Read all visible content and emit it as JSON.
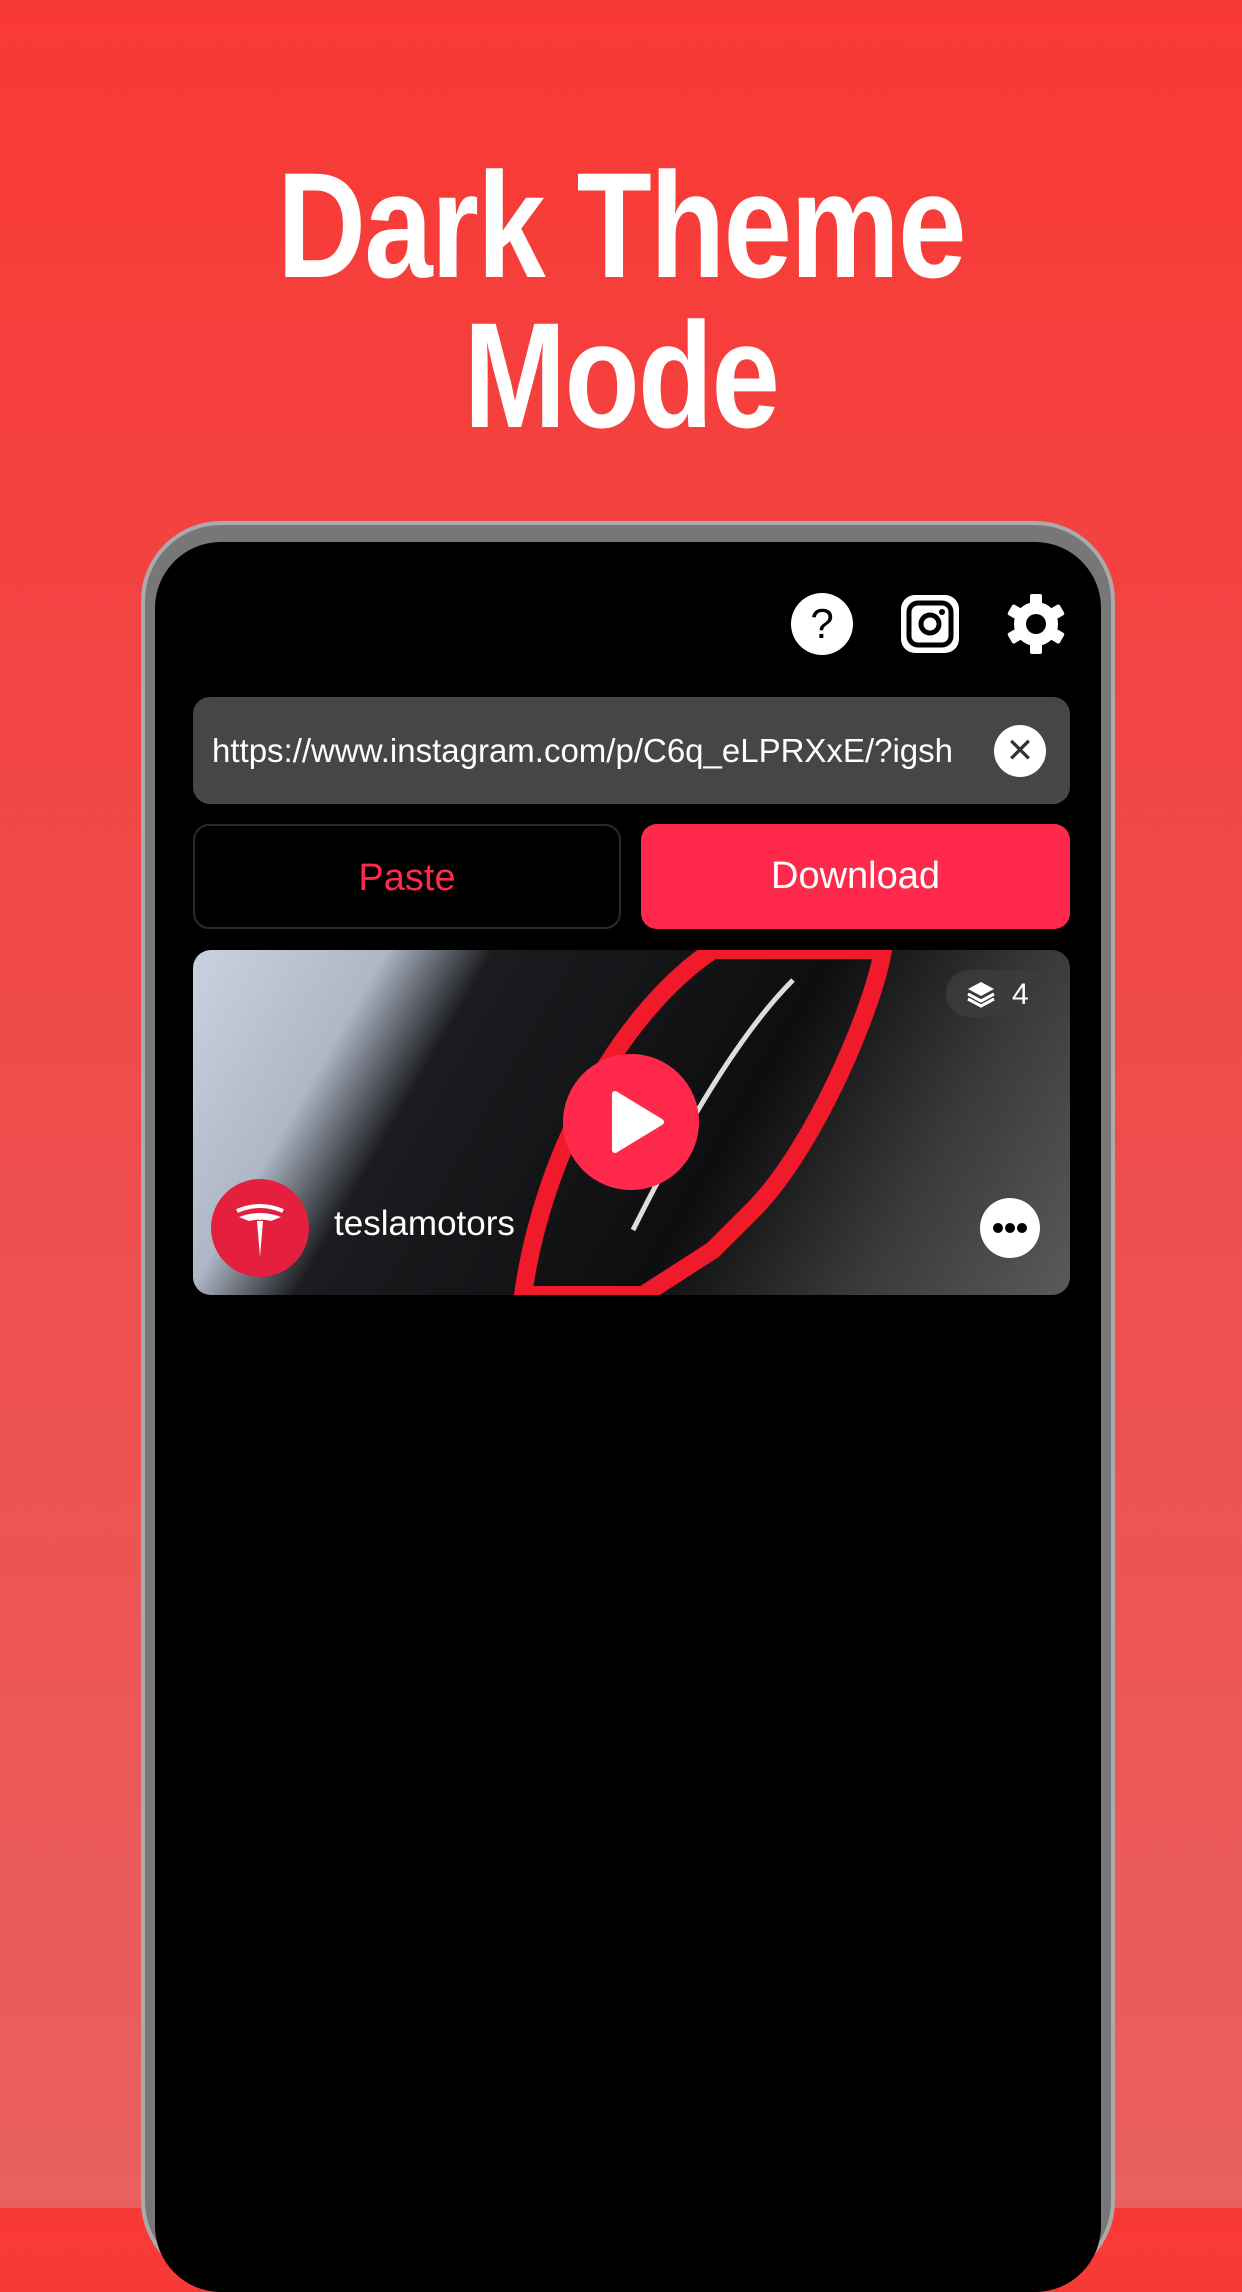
{
  "headline": "Dark Theme Mode",
  "colors": {
    "accent": "#ff2a4b",
    "field_bg": "#464646",
    "screen_bg": "#000000"
  },
  "toolbar": {
    "icons": [
      "help-icon",
      "instagram-icon",
      "settings-icon"
    ]
  },
  "url_input": {
    "value": "https://www.instagram.com/p/C6q_eLPRXxE/?igsh"
  },
  "buttons": {
    "paste": "Paste",
    "download": "Download"
  },
  "post": {
    "username": "teslamotors",
    "media_count": "4"
  }
}
